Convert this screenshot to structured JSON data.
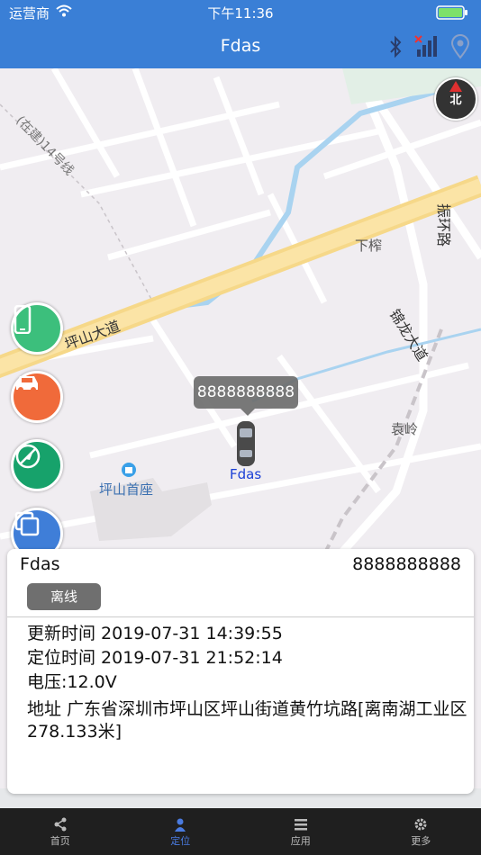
{
  "status_bar": {
    "carrier": "运营商",
    "time": "下午11:36"
  },
  "header": {
    "title": "Fdas"
  },
  "map": {
    "compass_label": "北",
    "road_labels": [
      "坪山大道",
      "锦龙大道",
      "振环路",
      "(在建)14号线"
    ],
    "place_labels": [
      "下榨",
      "袁岭",
      "坪山首座"
    ],
    "marker": {
      "callout": "8888888888",
      "label": "Fdas"
    }
  },
  "device_panel": {
    "name": "Fdas",
    "imei": "8888888888",
    "status": "离线",
    "update_time": "更新时间 2019-07-31 14:39:55",
    "locate_time": "定位时间 2019-07-31 21:52:14",
    "voltage": "电压:12.0V",
    "address": "地址 广东省深圳市坪山区坪山街道黄竹坑路[离南湖工业区278.133米]"
  },
  "tab_bar": {
    "tabs": [
      {
        "label": "首页",
        "icon": "share-icon"
      },
      {
        "label": "定位",
        "icon": "person-icon"
      },
      {
        "label": "应用",
        "icon": "list-icon"
      },
      {
        "label": "更多",
        "icon": "gear-icon"
      }
    ],
    "active_index": 1
  },
  "colors": {
    "header": "#3a7fd6",
    "tab_active": "#4a7be0",
    "status_offline": "#6f6f6f"
  }
}
